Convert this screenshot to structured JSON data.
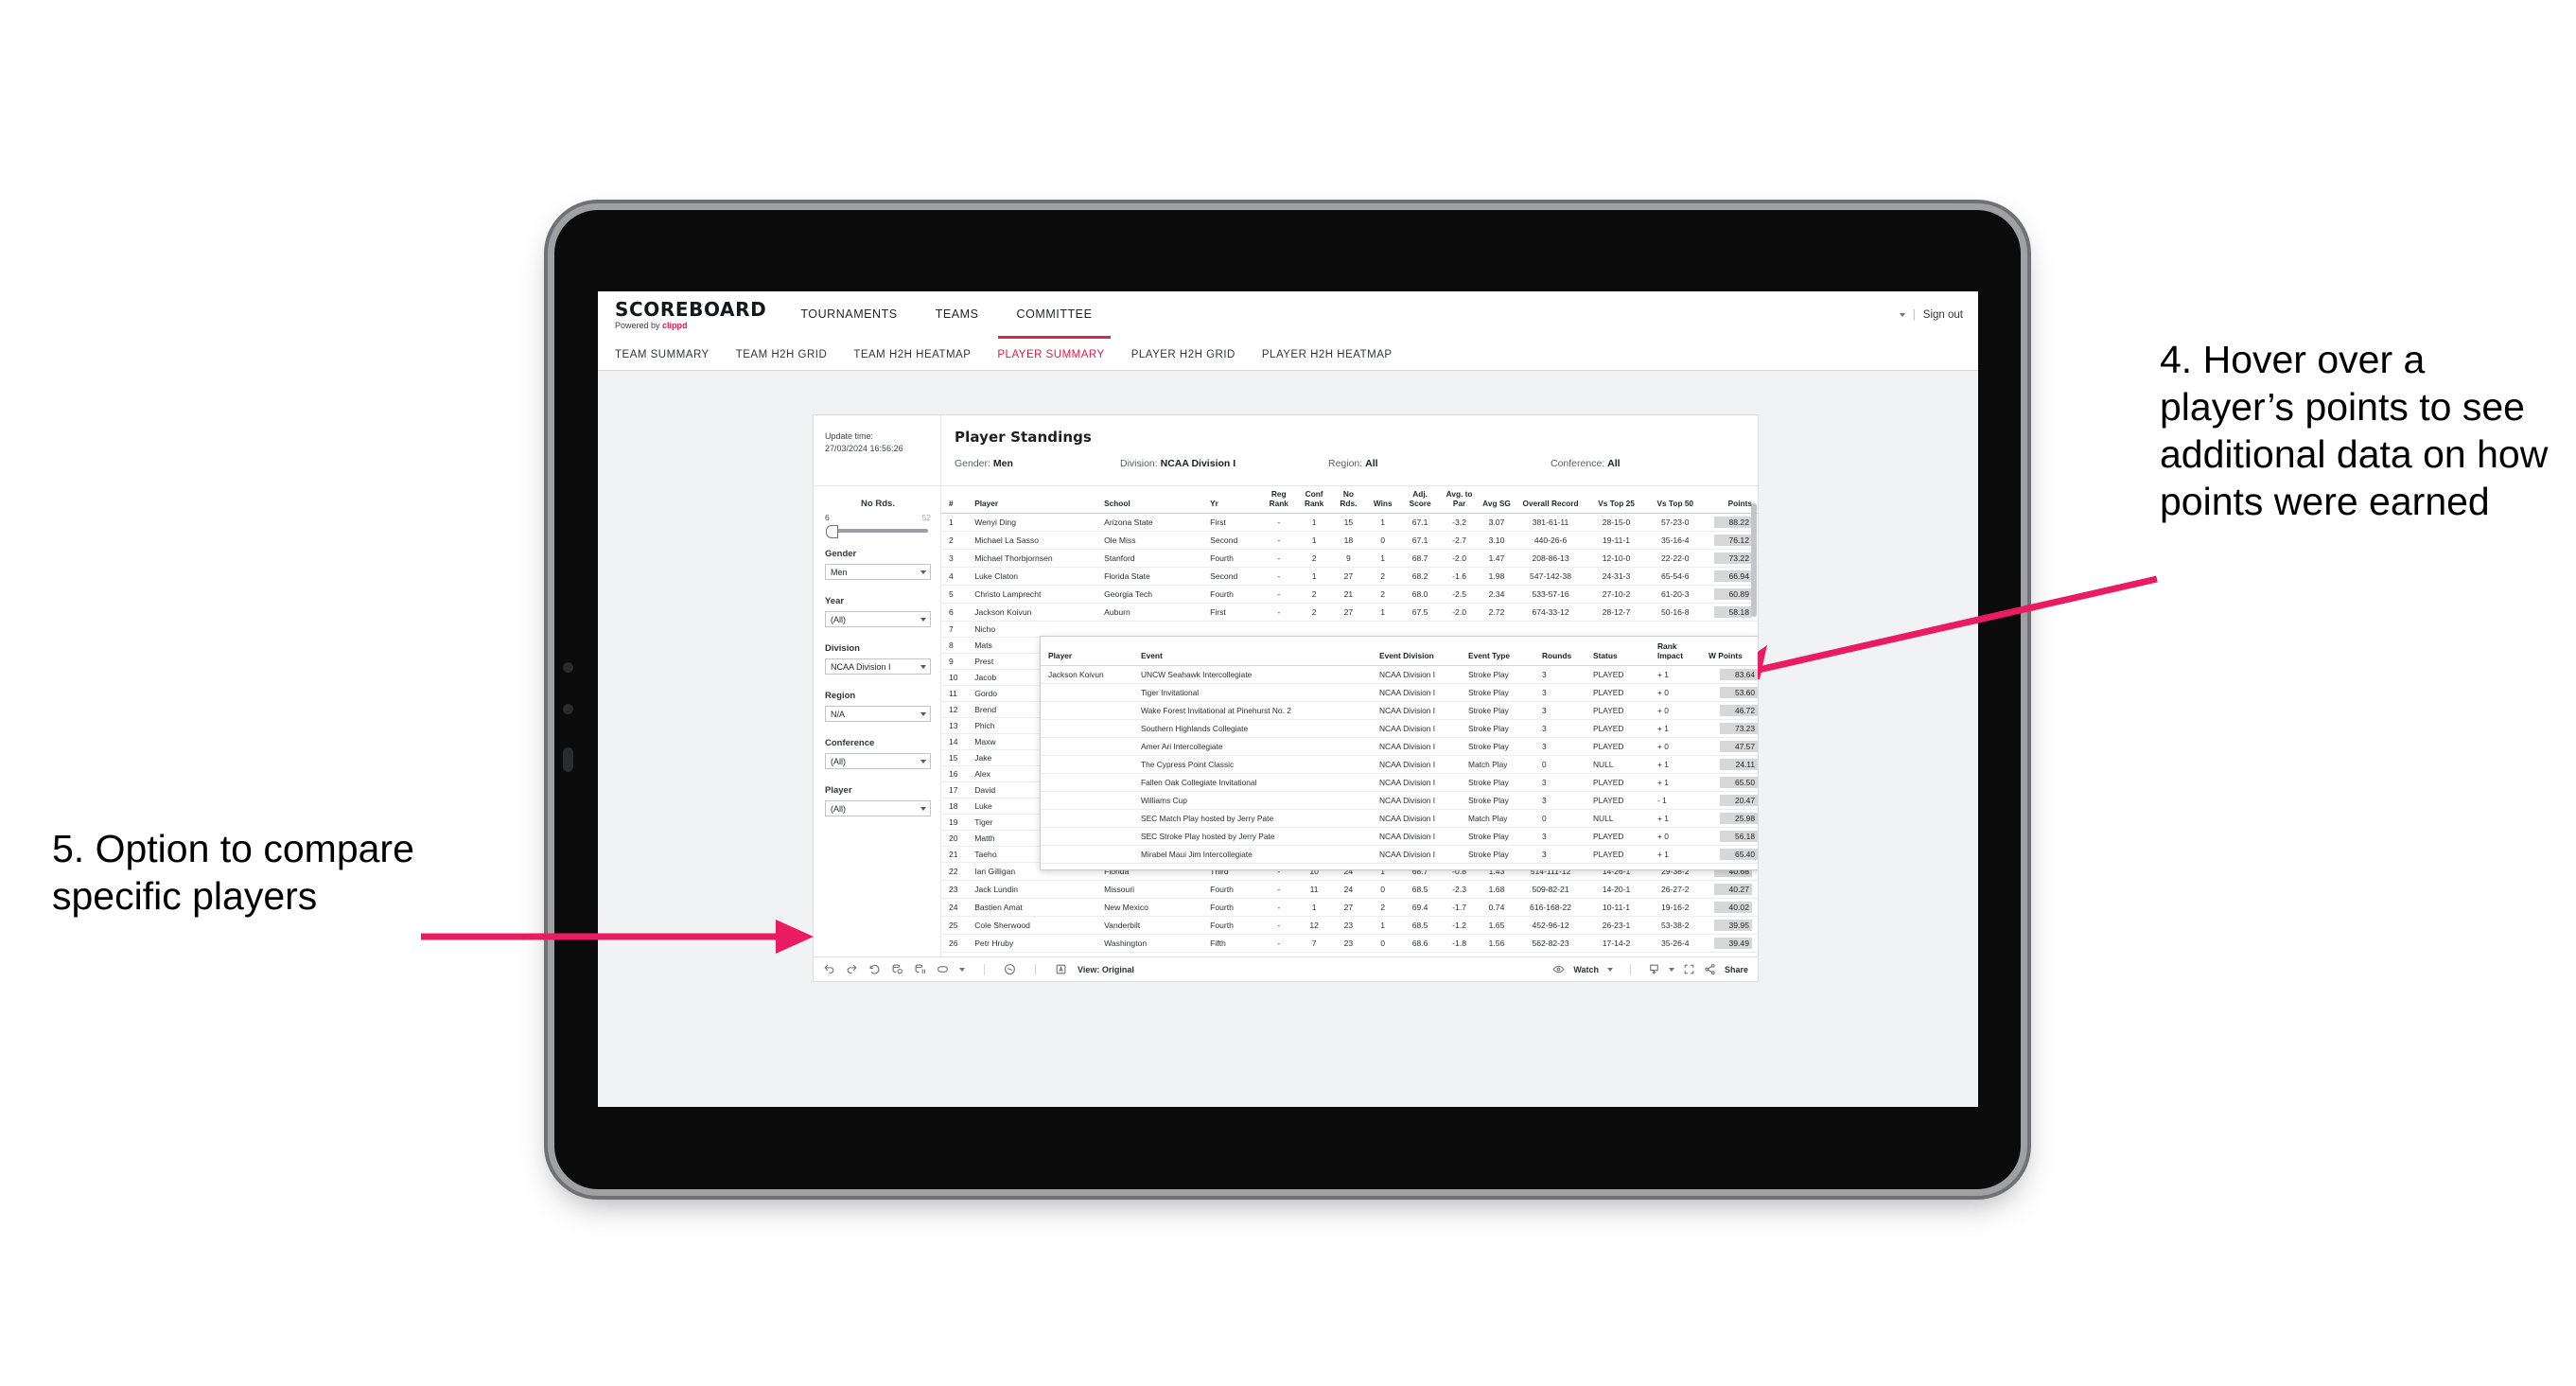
{
  "theme": {
    "accent": "#e5174c",
    "accent_underline": "#d32a52",
    "arrow": "#ea1b60",
    "page_bg": "#ffffff",
    "viz_bg": "#f1f2f4"
  },
  "header": {
    "brand_title": "SCOREBOARD",
    "brand_sub_prefix": "Powered by ",
    "brand_sub_mark": "clippd",
    "nav": [
      {
        "label": "TOURNAMENTS",
        "active": false
      },
      {
        "label": "TEAMS",
        "active": false
      },
      {
        "label": "COMMITTEE",
        "active": true
      }
    ],
    "right": {
      "divider": "|",
      "sign_out": "Sign out"
    }
  },
  "sub_nav": [
    {
      "label": "TEAM SUMMARY",
      "active": false
    },
    {
      "label": "TEAM H2H GRID",
      "active": false
    },
    {
      "label": "TEAM H2H HEATMAP",
      "active": false
    },
    {
      "label": "PLAYER SUMMARY",
      "active": true
    },
    {
      "label": "PLAYER H2H GRID",
      "active": false
    },
    {
      "label": "PLAYER H2H HEATMAP",
      "active": false
    }
  ],
  "sheet": {
    "update_time_label": "Update time:",
    "update_time_value": "27/03/2024 16:56:26",
    "title": "Player Standings",
    "summary": [
      {
        "key": "Gender:",
        "value": "Men"
      },
      {
        "key": "Division:",
        "value": "NCAA Division I"
      },
      {
        "key": "Region:",
        "value": "All"
      },
      {
        "key": "Conference:",
        "value": "All"
      }
    ]
  },
  "filters": {
    "slider": {
      "label": "No Rds.",
      "min": "6",
      "max": "52"
    },
    "controls": [
      {
        "label": "Gender",
        "value": "Men"
      },
      {
        "label": "Year",
        "value": "(All)"
      },
      {
        "label": "Division",
        "value": "NCAA Division I"
      },
      {
        "label": "Region",
        "value": "N/A"
      },
      {
        "label": "Conference",
        "value": "(All)"
      },
      {
        "label": "Player",
        "value": "(All)"
      }
    ]
  },
  "standings": {
    "columns": [
      {
        "key": "rank",
        "label": "#"
      },
      {
        "key": "player",
        "label": "Player"
      },
      {
        "key": "school",
        "label": "School"
      },
      {
        "key": "yr",
        "label": "Yr"
      },
      {
        "key": "reg_rank",
        "label": "Reg Rank"
      },
      {
        "key": "conf_rank",
        "label": "Conf Rank"
      },
      {
        "key": "no_rds",
        "label": "No Rds."
      },
      {
        "key": "wins",
        "label": "Wins"
      },
      {
        "key": "adj_score",
        "label": "Adj. Score"
      },
      {
        "key": "avg_to_par",
        "label": "Avg. to Par"
      },
      {
        "key": "avg_sg",
        "label": "Avg SG"
      },
      {
        "key": "overall_record",
        "label": "Overall Record"
      },
      {
        "key": "vs_top_25",
        "label": "Vs Top 25"
      },
      {
        "key": "vs_top_50",
        "label": "Vs Top 50"
      },
      {
        "key": "points",
        "label": "Points"
      }
    ],
    "rows": [
      {
        "rank": "1",
        "player": "Wenyi Ding",
        "school": "Arizona State",
        "yr": "First",
        "reg_rank": "-",
        "conf_rank": "1",
        "no_rds": "15",
        "wins": "1",
        "adj_score": "67.1",
        "avg_to_par": "-3.2",
        "avg_sg": "3.07",
        "overall_record": "381-61-11",
        "vs_top_25": "28-15-0",
        "vs_top_50": "57-23-0",
        "points": "88.22"
      },
      {
        "rank": "2",
        "player": "Michael La Sasso",
        "school": "Ole Miss",
        "yr": "Second",
        "reg_rank": "-",
        "conf_rank": "1",
        "no_rds": "18",
        "wins": "0",
        "adj_score": "67.1",
        "avg_to_par": "-2.7",
        "avg_sg": "3.10",
        "overall_record": "440-26-6",
        "vs_top_25": "19-11-1",
        "vs_top_50": "35-16-4",
        "points": "76.12"
      },
      {
        "rank": "3",
        "player": "Michael Thorbjornsen",
        "school": "Stanford",
        "yr": "Fourth",
        "reg_rank": "-",
        "conf_rank": "2",
        "no_rds": "9",
        "wins": "1",
        "adj_score": "68.7",
        "avg_to_par": "-2.0",
        "avg_sg": "1.47",
        "overall_record": "208-86-13",
        "vs_top_25": "12-10-0",
        "vs_top_50": "22-22-0",
        "points": "73.22"
      },
      {
        "rank": "4",
        "player": "Luke Claton",
        "school": "Florida State",
        "yr": "Second",
        "reg_rank": "-",
        "conf_rank": "1",
        "no_rds": "27",
        "wins": "2",
        "adj_score": "68.2",
        "avg_to_par": "-1.6",
        "avg_sg": "1.98",
        "overall_record": "547-142-38",
        "vs_top_25": "24-31-3",
        "vs_top_50": "65-54-6",
        "points": "66.94"
      },
      {
        "rank": "5",
        "player": "Christo Lamprecht",
        "school": "Georgia Tech",
        "yr": "Fourth",
        "reg_rank": "-",
        "conf_rank": "2",
        "no_rds": "21",
        "wins": "2",
        "adj_score": "68.0",
        "avg_to_par": "-2.5",
        "avg_sg": "2.34",
        "overall_record": "533-57-16",
        "vs_top_25": "27-10-2",
        "vs_top_50": "61-20-3",
        "points": "60.89"
      },
      {
        "rank": "6",
        "player": "Jackson Koivun",
        "school": "Auburn",
        "yr": "First",
        "reg_rank": "-",
        "conf_rank": "2",
        "no_rds": "27",
        "wins": "1",
        "adj_score": "67.5",
        "avg_to_par": "-2.0",
        "avg_sg": "2.72",
        "overall_record": "674-33-12",
        "vs_top_25": "28-12-7",
        "vs_top_50": "50-16-8",
        "points": "58.18"
      },
      {
        "rank": "7",
        "player": "Nicho",
        "school": "",
        "yr": "",
        "reg_rank": "",
        "conf_rank": "",
        "no_rds": "",
        "wins": "",
        "adj_score": "",
        "avg_to_par": "",
        "avg_sg": "",
        "overall_record": "",
        "vs_top_25": "",
        "vs_top_50": "",
        "points": ""
      },
      {
        "rank": "8",
        "player": "Mats",
        "school": "",
        "yr": "",
        "reg_rank": "",
        "conf_rank": "",
        "no_rds": "",
        "wins": "",
        "adj_score": "",
        "avg_to_par": "",
        "avg_sg": "",
        "overall_record": "",
        "vs_top_25": "",
        "vs_top_50": "",
        "points": ""
      },
      {
        "rank": "9",
        "player": "Prest",
        "school": "",
        "yr": "",
        "reg_rank": "",
        "conf_rank": "",
        "no_rds": "",
        "wins": "",
        "adj_score": "",
        "avg_to_par": "",
        "avg_sg": "",
        "overall_record": "",
        "vs_top_25": "",
        "vs_top_50": "",
        "points": ""
      },
      {
        "rank": "10",
        "player": "Jacob",
        "school": "",
        "yr": "",
        "reg_rank": "",
        "conf_rank": "",
        "no_rds": "",
        "wins": "",
        "adj_score": "",
        "avg_to_par": "",
        "avg_sg": "",
        "overall_record": "",
        "vs_top_25": "",
        "vs_top_50": "",
        "points": ""
      },
      {
        "rank": "11",
        "player": "Gordo",
        "school": "",
        "yr": "",
        "reg_rank": "",
        "conf_rank": "",
        "no_rds": "",
        "wins": "",
        "adj_score": "",
        "avg_to_par": "",
        "avg_sg": "",
        "overall_record": "",
        "vs_top_25": "",
        "vs_top_50": "",
        "points": ""
      },
      {
        "rank": "12",
        "player": "Brend",
        "school": "",
        "yr": "",
        "reg_rank": "",
        "conf_rank": "",
        "no_rds": "",
        "wins": "",
        "adj_score": "",
        "avg_to_par": "",
        "avg_sg": "",
        "overall_record": "",
        "vs_top_25": "",
        "vs_top_50": "",
        "points": ""
      },
      {
        "rank": "13",
        "player": "Phich",
        "school": "",
        "yr": "",
        "reg_rank": "",
        "conf_rank": "",
        "no_rds": "",
        "wins": "",
        "adj_score": "",
        "avg_to_par": "",
        "avg_sg": "",
        "overall_record": "",
        "vs_top_25": "",
        "vs_top_50": "",
        "points": ""
      },
      {
        "rank": "14",
        "player": "Maxw",
        "school": "",
        "yr": "",
        "reg_rank": "",
        "conf_rank": "",
        "no_rds": "",
        "wins": "",
        "adj_score": "",
        "avg_to_par": "",
        "avg_sg": "",
        "overall_record": "",
        "vs_top_25": "",
        "vs_top_50": "",
        "points": ""
      },
      {
        "rank": "15",
        "player": "Jake",
        "school": "",
        "yr": "",
        "reg_rank": "",
        "conf_rank": "",
        "no_rds": "",
        "wins": "",
        "adj_score": "",
        "avg_to_par": "",
        "avg_sg": "",
        "overall_record": "",
        "vs_top_25": "",
        "vs_top_50": "",
        "points": ""
      },
      {
        "rank": "16",
        "player": "Alex",
        "school": "",
        "yr": "",
        "reg_rank": "",
        "conf_rank": "",
        "no_rds": "",
        "wins": "",
        "adj_score": "",
        "avg_to_par": "",
        "avg_sg": "",
        "overall_record": "",
        "vs_top_25": "",
        "vs_top_50": "",
        "points": ""
      },
      {
        "rank": "17",
        "player": "David",
        "school": "",
        "yr": "",
        "reg_rank": "",
        "conf_rank": "",
        "no_rds": "",
        "wins": "",
        "adj_score": "",
        "avg_to_par": "",
        "avg_sg": "",
        "overall_record": "",
        "vs_top_25": "",
        "vs_top_50": "",
        "points": ""
      },
      {
        "rank": "18",
        "player": "Luke",
        "school": "",
        "yr": "",
        "reg_rank": "",
        "conf_rank": "",
        "no_rds": "",
        "wins": "",
        "adj_score": "",
        "avg_to_par": "",
        "avg_sg": "",
        "overall_record": "",
        "vs_top_25": "",
        "vs_top_50": "",
        "points": ""
      },
      {
        "rank": "19",
        "player": "Tiger",
        "school": "",
        "yr": "",
        "reg_rank": "",
        "conf_rank": "",
        "no_rds": "",
        "wins": "",
        "adj_score": "",
        "avg_to_par": "",
        "avg_sg": "",
        "overall_record": "",
        "vs_top_25": "",
        "vs_top_50": "",
        "points": ""
      },
      {
        "rank": "20",
        "player": "Matth",
        "school": "",
        "yr": "",
        "reg_rank": "",
        "conf_rank": "",
        "no_rds": "",
        "wins": "",
        "adj_score": "",
        "avg_to_par": "",
        "avg_sg": "",
        "overall_record": "",
        "vs_top_25": "",
        "vs_top_50": "",
        "points": ""
      },
      {
        "rank": "21",
        "player": "Taeho",
        "school": "",
        "yr": "",
        "reg_rank": "",
        "conf_rank": "",
        "no_rds": "",
        "wins": "",
        "adj_score": "",
        "avg_to_par": "",
        "avg_sg": "",
        "overall_record": "",
        "vs_top_25": "",
        "vs_top_50": "",
        "points": ""
      },
      {
        "rank": "22",
        "player": "Ian Gilligan",
        "school": "Florida",
        "yr": "Third",
        "reg_rank": "-",
        "conf_rank": "10",
        "no_rds": "24",
        "wins": "1",
        "adj_score": "68.7",
        "avg_to_par": "-0.8",
        "avg_sg": "1.43",
        "overall_record": "514-111-12",
        "vs_top_25": "14-26-1",
        "vs_top_50": "29-38-2",
        "points": "40.68"
      },
      {
        "rank": "23",
        "player": "Jack Lundin",
        "school": "Missouri",
        "yr": "Fourth",
        "reg_rank": "-",
        "conf_rank": "11",
        "no_rds": "24",
        "wins": "0",
        "adj_score": "68.5",
        "avg_to_par": "-2.3",
        "avg_sg": "1.68",
        "overall_record": "509-82-21",
        "vs_top_25": "14-20-1",
        "vs_top_50": "26-27-2",
        "points": "40.27"
      },
      {
        "rank": "24",
        "player": "Bastien Amat",
        "school": "New Mexico",
        "yr": "Fourth",
        "reg_rank": "-",
        "conf_rank": "1",
        "no_rds": "27",
        "wins": "2",
        "adj_score": "69.4",
        "avg_to_par": "-1.7",
        "avg_sg": "0.74",
        "overall_record": "616-168-22",
        "vs_top_25": "10-11-1",
        "vs_top_50": "19-16-2",
        "points": "40.02"
      },
      {
        "rank": "25",
        "player": "Cole Sherwood",
        "school": "Vanderbilt",
        "yr": "Fourth",
        "reg_rank": "-",
        "conf_rank": "12",
        "no_rds": "23",
        "wins": "1",
        "adj_score": "68.5",
        "avg_to_par": "-1.2",
        "avg_sg": "1.65",
        "overall_record": "452-96-12",
        "vs_top_25": "26-23-1",
        "vs_top_50": "53-38-2",
        "points": "39.95"
      },
      {
        "rank": "26",
        "player": "Petr Hruby",
        "school": "Washington",
        "yr": "Fifth",
        "reg_rank": "-",
        "conf_rank": "7",
        "no_rds": "23",
        "wins": "0",
        "adj_score": "68.6",
        "avg_to_par": "-1.8",
        "avg_sg": "1.56",
        "overall_record": "562-82-23",
        "vs_top_25": "17-14-2",
        "vs_top_50": "35-26-4",
        "points": "39.49"
      }
    ]
  },
  "tooltip": {
    "columns": [
      {
        "key": "player",
        "label": "Player"
      },
      {
        "key": "event",
        "label": "Event"
      },
      {
        "key": "event_division",
        "label": "Event Division"
      },
      {
        "key": "event_type",
        "label": "Event Type"
      },
      {
        "key": "rounds",
        "label": "Rounds"
      },
      {
        "key": "status",
        "label": "Status"
      },
      {
        "key": "rank_impact",
        "label": "Rank Impact"
      },
      {
        "key": "w_points",
        "label": "W Points"
      }
    ],
    "rows": [
      {
        "player": "Jackson Koivun",
        "event": "UNCW Seahawk Intercollegiate",
        "event_division": "NCAA Division I",
        "event_type": "Stroke Play",
        "rounds": "3",
        "status": "PLAYED",
        "rank_impact": "+ 1",
        "w_points": "83.64"
      },
      {
        "player": "",
        "event": "Tiger Invitational",
        "event_division": "NCAA Division I",
        "event_type": "Stroke Play",
        "rounds": "3",
        "status": "PLAYED",
        "rank_impact": "+ 0",
        "w_points": "53.60"
      },
      {
        "player": "",
        "event": "Wake Forest Invitational at Pinehurst No. 2",
        "event_division": "NCAA Division I",
        "event_type": "Stroke Play",
        "rounds": "3",
        "status": "PLAYED",
        "rank_impact": "+ 0",
        "w_points": "46.72"
      },
      {
        "player": "",
        "event": "Southern Highlands Collegiate",
        "event_division": "NCAA Division I",
        "event_type": "Stroke Play",
        "rounds": "3",
        "status": "PLAYED",
        "rank_impact": "+ 1",
        "w_points": "73.23"
      },
      {
        "player": "",
        "event": "Amer Ari Intercollegiate",
        "event_division": "NCAA Division I",
        "event_type": "Stroke Play",
        "rounds": "3",
        "status": "PLAYED",
        "rank_impact": "+ 0",
        "w_points": "47.57"
      },
      {
        "player": "",
        "event": "The Cypress Point Classic",
        "event_division": "NCAA Division I",
        "event_type": "Match Play",
        "rounds": "0",
        "status": "NULL",
        "rank_impact": "+ 1",
        "w_points": "24.11"
      },
      {
        "player": "",
        "event": "Fallen Oak Collegiate Invitational",
        "event_division": "NCAA Division I",
        "event_type": "Stroke Play",
        "rounds": "3",
        "status": "PLAYED",
        "rank_impact": "+ 1",
        "w_points": "65.50"
      },
      {
        "player": "",
        "event": "Williams Cup",
        "event_division": "NCAA Division I",
        "event_type": "Stroke Play",
        "rounds": "3",
        "status": "PLAYED",
        "rank_impact": "- 1",
        "w_points": "20.47"
      },
      {
        "player": "",
        "event": "SEC Match Play hosted by Jerry Pate",
        "event_division": "NCAA Division I",
        "event_type": "Match Play",
        "rounds": "0",
        "status": "NULL",
        "rank_impact": "+ 1",
        "w_points": "25.98"
      },
      {
        "player": "",
        "event": "SEC Stroke Play hosted by Jerry Pate",
        "event_division": "NCAA Division I",
        "event_type": "Stroke Play",
        "rounds": "3",
        "status": "PLAYED",
        "rank_impact": "+ 0",
        "w_points": "56.18"
      },
      {
        "player": "",
        "event": "Mirabel Maui Jim Intercollegiate",
        "event_division": "NCAA Division I",
        "event_type": "Stroke Play",
        "rounds": "3",
        "status": "PLAYED",
        "rank_impact": "+ 1",
        "w_points": "65.40"
      }
    ]
  },
  "toolbar": {
    "view_label": "View: Original",
    "watch_label": "Watch",
    "share_label": "Share"
  },
  "annotations": {
    "four": "4. Hover over a player’s points to see additional data on how points were earned",
    "five": "5. Option to compare specific players"
  }
}
